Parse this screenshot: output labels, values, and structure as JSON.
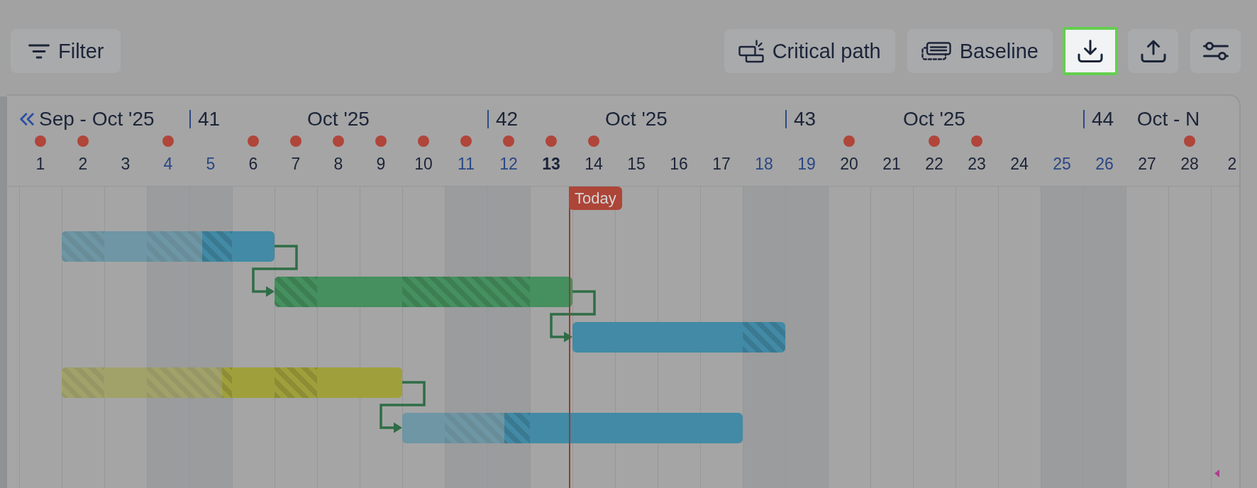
{
  "toolbar": {
    "filter": {
      "label": "Filter"
    },
    "buttons": [
      {
        "label": "Critical path"
      },
      {
        "label": "Baseline"
      }
    ],
    "icon_buttons": [
      {
        "highlighted": true
      },
      {
        "highlighted": false
      },
      {
        "highlighted": false
      }
    ]
  },
  "timeline": {
    "weeks": [
      {
        "month": "Sep - Oct '25",
        "days": [
          {
            "label": "1",
            "weekend": false,
            "marker": true,
            "today": false
          },
          {
            "label": "2",
            "weekend": false,
            "marker": true,
            "today": false
          },
          {
            "label": "3",
            "weekend": false,
            "marker": false,
            "today": false
          },
          {
            "label": "4",
            "weekend": true,
            "marker": true,
            "today": false
          }
        ]
      },
      {
        "number": "41",
        "month": "Oct '25",
        "days": [
          {
            "label": "5",
            "weekend": true,
            "marker": false,
            "today": false
          },
          {
            "label": "6",
            "weekend": false,
            "marker": true,
            "today": false
          },
          {
            "label": "7",
            "weekend": false,
            "marker": true,
            "today": false
          },
          {
            "label": "8",
            "weekend": false,
            "marker": true,
            "today": false
          },
          {
            "label": "9",
            "weekend": false,
            "marker": true,
            "today": false
          },
          {
            "label": "10",
            "weekend": false,
            "marker": true,
            "today": false
          },
          {
            "label": "11",
            "weekend": true,
            "marker": true,
            "today": false
          }
        ]
      },
      {
        "number": "42",
        "month": "Oct '25",
        "days": [
          {
            "label": "12",
            "weekend": true,
            "marker": true,
            "today": false
          },
          {
            "label": "13",
            "weekend": false,
            "marker": true,
            "today": true
          },
          {
            "label": "14",
            "weekend": false,
            "marker": true,
            "today": false
          },
          {
            "label": "15",
            "weekend": false,
            "marker": false,
            "today": false
          },
          {
            "label": "16",
            "weekend": false,
            "marker": false,
            "today": false
          },
          {
            "label": "17",
            "weekend": false,
            "marker": false,
            "today": false
          },
          {
            "label": "18",
            "weekend": true,
            "marker": false,
            "today": false
          }
        ]
      },
      {
        "number": "43",
        "month": "Oct '25",
        "days": [
          {
            "label": "19",
            "weekend": true,
            "marker": false,
            "today": false
          },
          {
            "label": "20",
            "weekend": false,
            "marker": true,
            "today": false
          },
          {
            "label": "21",
            "weekend": false,
            "marker": false,
            "today": false
          },
          {
            "label": "22",
            "weekend": false,
            "marker": true,
            "today": false
          },
          {
            "label": "23",
            "weekend": false,
            "marker": true,
            "today": false
          },
          {
            "label": "24",
            "weekend": false,
            "marker": false,
            "today": false
          },
          {
            "label": "25",
            "weekend": true,
            "marker": false,
            "today": false
          }
        ]
      },
      {
        "number": "44",
        "month": "Oct - N",
        "days": [
          {
            "label": "26",
            "weekend": true,
            "marker": false,
            "today": false
          },
          {
            "label": "27",
            "weekend": false,
            "marker": false,
            "today": false
          },
          {
            "label": "28",
            "weekend": false,
            "marker": true,
            "today": false
          },
          {
            "label": "2",
            "weekend": false,
            "marker": false,
            "today": false
          }
        ]
      }
    ],
    "today_label": "Today",
    "tasks": [
      {
        "color": "#428aa5",
        "level": 0.66,
        "linked": false,
        "cells": [
          {
            "kind": "empty"
          },
          {
            "kind": "hatched"
          },
          {
            "kind": "plain"
          },
          {
            "kind": "hatched"
          },
          {
            "kind": "hatched"
          },
          {
            "kind": "plain"
          },
          {
            "kind": "empty"
          },
          {
            "kind": "empty"
          },
          {
            "kind": "empty"
          },
          {
            "kind": "empty"
          },
          {
            "kind": "empty"
          },
          {
            "kind": "empty"
          },
          {
            "kind": "empty"
          },
          {
            "kind": "empty"
          },
          {
            "kind": "empty"
          },
          {
            "kind": "empty"
          },
          {
            "kind": "empty"
          },
          {
            "kind": "empty"
          },
          {
            "kind": "empty"
          },
          {
            "kind": "empty"
          },
          {
            "kind": "empty"
          },
          {
            "kind": "empty"
          },
          {
            "kind": "empty"
          },
          {
            "kind": "empty"
          },
          {
            "kind": "empty"
          },
          {
            "kind": "empty"
          },
          {
            "kind": "empty"
          },
          {
            "kind": "empty"
          },
          {
            "kind": "empty"
          }
        ]
      },
      {
        "color": "#45905e",
        "linked": true,
        "cells": [
          {
            "kind": "empty"
          },
          {
            "kind": "empty"
          },
          {
            "kind": "empty"
          },
          {
            "kind": "empty"
          },
          {
            "kind": "empty"
          },
          {
            "kind": "empty"
          },
          {
            "kind": "hatched"
          },
          {
            "kind": "plain"
          },
          {
            "kind": "plain"
          },
          {
            "kind": "hatched"
          },
          {
            "kind": "hatched"
          },
          {
            "kind": "hatched"
          },
          {
            "kind": "plain"
          },
          {
            "kind": "empty"
          },
          {
            "kind": "empty"
          },
          {
            "kind": "empty"
          },
          {
            "kind": "empty"
          },
          {
            "kind": "empty"
          },
          {
            "kind": "empty"
          },
          {
            "kind": "empty"
          },
          {
            "kind": "empty"
          },
          {
            "kind": "empty"
          },
          {
            "kind": "empty"
          },
          {
            "kind": "empty"
          },
          {
            "kind": "empty"
          },
          {
            "kind": "empty"
          },
          {
            "kind": "empty"
          },
          {
            "kind": "empty"
          },
          {
            "kind": "empty"
          }
        ]
      },
      {
        "color": "#428aa5",
        "linked": true,
        "cells": [
          {
            "kind": "empty"
          },
          {
            "kind": "empty"
          },
          {
            "kind": "empty"
          },
          {
            "kind": "empty"
          },
          {
            "kind": "empty"
          },
          {
            "kind": "empty"
          },
          {
            "kind": "empty"
          },
          {
            "kind": "empty"
          },
          {
            "kind": "empty"
          },
          {
            "kind": "empty"
          },
          {
            "kind": "empty"
          },
          {
            "kind": "empty"
          },
          {
            "kind": "empty"
          },
          {
            "kind": "plain"
          },
          {
            "kind": "plain"
          },
          {
            "kind": "plain"
          },
          {
            "kind": "plain"
          },
          {
            "kind": "hatched"
          },
          {
            "kind": "empty"
          },
          {
            "kind": "empty"
          },
          {
            "kind": "empty"
          },
          {
            "kind": "empty"
          },
          {
            "kind": "empty"
          },
          {
            "kind": "empty"
          },
          {
            "kind": "empty"
          },
          {
            "kind": "empty"
          },
          {
            "kind": "empty"
          },
          {
            "kind": "empty"
          },
          {
            "kind": "empty"
          }
        ]
      },
      {
        "color": "#9fa03b",
        "level": 0.47,
        "linked": false,
        "cells": [
          {
            "kind": "empty"
          },
          {
            "kind": "hatched"
          },
          {
            "kind": "plain"
          },
          {
            "kind": "hatched"
          },
          {
            "kind": "hatched"
          },
          {
            "kind": "plain"
          },
          {
            "kind": "hatched"
          },
          {
            "kind": "plain"
          },
          {
            "kind": "plain"
          },
          {
            "kind": "empty"
          },
          {
            "kind": "empty"
          },
          {
            "kind": "empty"
          },
          {
            "kind": "empty"
          },
          {
            "kind": "empty"
          },
          {
            "kind": "empty"
          },
          {
            "kind": "empty"
          },
          {
            "kind": "empty"
          },
          {
            "kind": "empty"
          },
          {
            "kind": "empty"
          },
          {
            "kind": "empty"
          },
          {
            "kind": "empty"
          },
          {
            "kind": "empty"
          },
          {
            "kind": "empty"
          },
          {
            "kind": "empty"
          },
          {
            "kind": "empty"
          },
          {
            "kind": "empty"
          },
          {
            "kind": "empty"
          },
          {
            "kind": "empty"
          },
          {
            "kind": "empty"
          }
        ]
      },
      {
        "color": "#428aa5",
        "level": 0.3,
        "linked": true,
        "cells": [
          {
            "kind": "empty"
          },
          {
            "kind": "empty"
          },
          {
            "kind": "empty"
          },
          {
            "kind": "empty"
          },
          {
            "kind": "empty"
          },
          {
            "kind": "empty"
          },
          {
            "kind": "empty"
          },
          {
            "kind": "empty"
          },
          {
            "kind": "empty"
          },
          {
            "kind": "plain"
          },
          {
            "kind": "hatched"
          },
          {
            "kind": "hatched"
          },
          {
            "kind": "plain"
          },
          {
            "kind": "plain"
          },
          {
            "kind": "plain"
          },
          {
            "kind": "plain"
          },
          {
            "kind": "plain"
          },
          {
            "kind": "empty"
          },
          {
            "kind": "empty"
          },
          {
            "kind": "empty"
          },
          {
            "kind": "empty"
          },
          {
            "kind": "empty"
          },
          {
            "kind": "empty"
          },
          {
            "kind": "empty"
          },
          {
            "kind": "empty"
          },
          {
            "kind": "empty"
          },
          {
            "kind": "empty"
          },
          {
            "kind": "empty"
          },
          {
            "kind": "empty"
          }
        ]
      },
      {
        "color": "#b03d8e",
        "linked": false,
        "cells": [
          {
            "kind": "empty"
          },
          {
            "kind": "empty"
          },
          {
            "kind": "empty"
          },
          {
            "kind": "empty"
          },
          {
            "kind": "empty"
          },
          {
            "kind": "empty"
          },
          {
            "kind": "empty"
          },
          {
            "kind": "empty"
          },
          {
            "kind": "empty"
          },
          {
            "kind": "empty"
          },
          {
            "kind": "empty"
          },
          {
            "kind": "empty"
          },
          {
            "kind": "empty"
          },
          {
            "kind": "empty"
          },
          {
            "kind": "empty"
          },
          {
            "kind": "empty"
          },
          {
            "kind": "empty"
          },
          {
            "kind": "empty"
          },
          {
            "kind": "empty"
          },
          {
            "kind": "empty"
          },
          {
            "kind": "empty"
          },
          {
            "kind": "empty"
          },
          {
            "kind": "empty"
          },
          {
            "kind": "empty"
          },
          {
            "kind": "empty"
          },
          {
            "kind": "empty"
          },
          {
            "kind": "empty"
          },
          {
            "kind": "empty"
          },
          {
            "kind": "milestone"
          }
        ]
      }
    ]
  }
}
